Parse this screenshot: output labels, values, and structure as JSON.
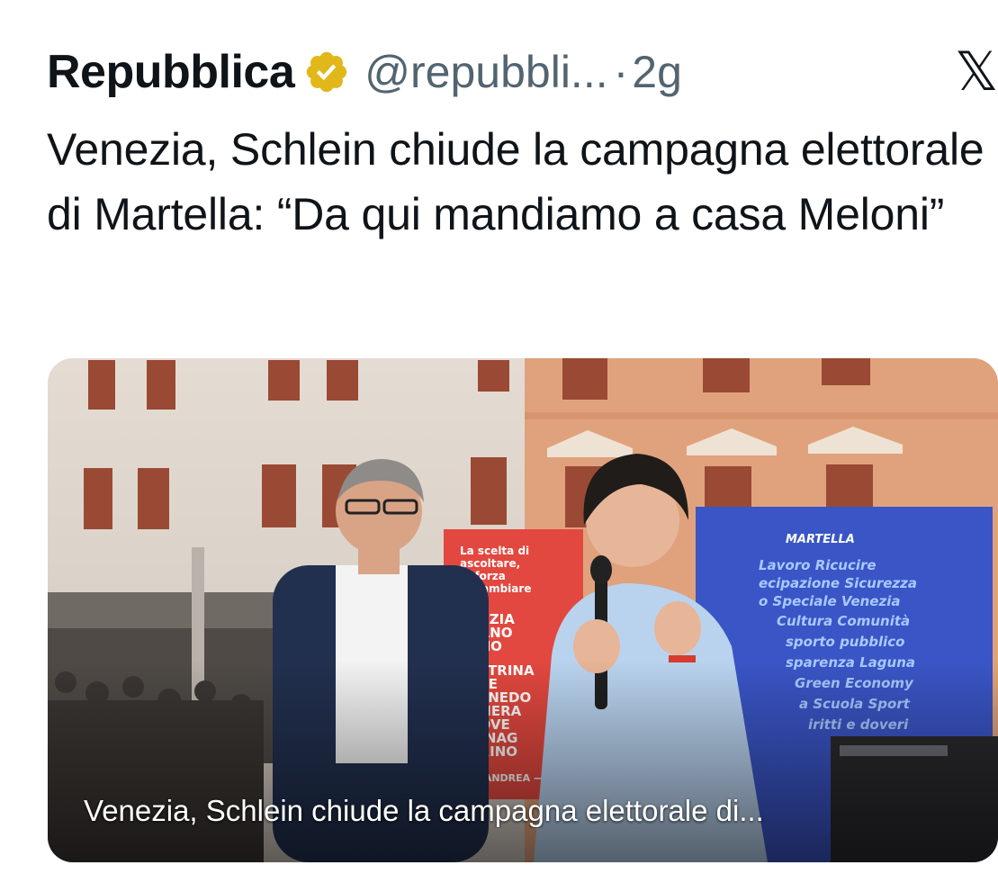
{
  "post": {
    "author": "Repubblica",
    "handle": "@repubbli...",
    "separator": "·",
    "time": "2g",
    "text": "Venezia, Schlein chiude la campagna elettorale di Martella: “Da qui mandiamo a casa Meloni”"
  },
  "card": {
    "caption": "Venezia, Schlein chiude la campagna elettorale di..."
  },
  "icons": {
    "verified": "verified-badge-icon",
    "platform": "x-logo-icon"
  },
  "colors": {
    "verified_gold": "#e2b719",
    "text": "#0f1419",
    "muted": "#536471"
  }
}
